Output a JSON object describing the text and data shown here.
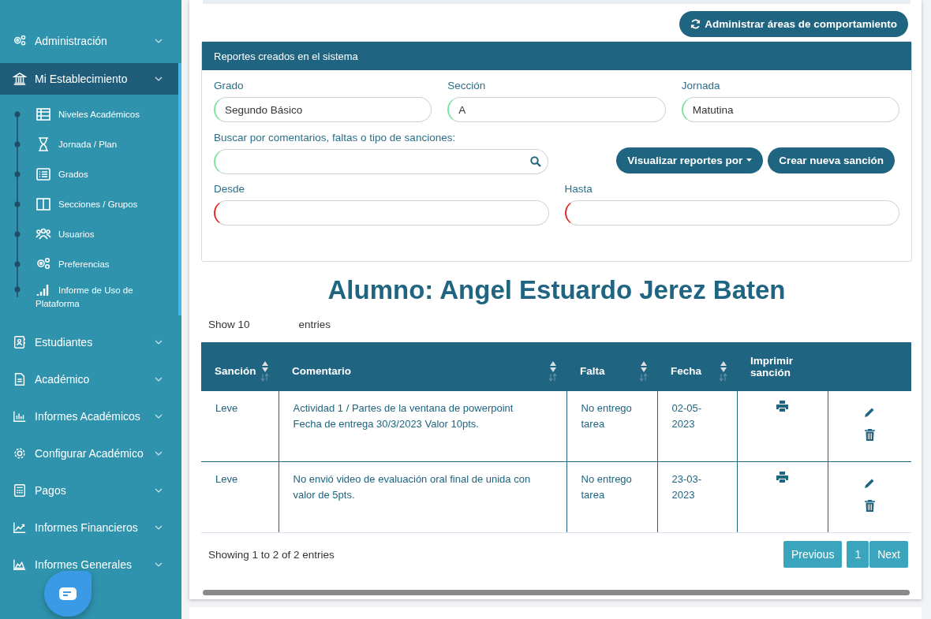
{
  "sidebar": {
    "items": [
      {
        "label": "Administración",
        "selected": false
      },
      {
        "label": "Mi Establecimiento",
        "selected": true,
        "children": [
          {
            "label": "Niveles Académicos"
          },
          {
            "label": "Jornada / Plan"
          },
          {
            "label": "Grados"
          },
          {
            "label": "Secciones / Grupos"
          },
          {
            "label": "Usuarios"
          },
          {
            "label": "Preferencias"
          },
          {
            "label": "Informe de Uso de Plataforma"
          }
        ]
      },
      {
        "label": "Estudiantes",
        "selected": false
      },
      {
        "label": "Académico",
        "selected": false
      },
      {
        "label": "Informes Académicos",
        "selected": false
      },
      {
        "label": "Configurar Académico",
        "selected": false
      },
      {
        "label": "Pagos",
        "selected": false
      },
      {
        "label": "Informes Financieros",
        "selected": false
      },
      {
        "label": "Informes Generales",
        "selected": false
      }
    ]
  },
  "toolbar": {
    "button": "Administrar áreas de comportamiento"
  },
  "panel": {
    "title": "Reportes creados en el sistema",
    "fields": [
      {
        "label": "Grado",
        "value": "Segundo Básico",
        "valid": true
      },
      {
        "label": "Sección",
        "value": "A",
        "valid": true
      },
      {
        "label": "Jornada",
        "value": "Matutina",
        "valid": true
      }
    ],
    "search": {
      "label": "Buscar por comentarios, faltas o tipo de sanciones:",
      "valid": true
    },
    "buttons": [
      {
        "label": "Visualizar reportes por",
        "kind": "dropdown"
      },
      {
        "label": "Crear nueva sanción",
        "kind": "plain"
      }
    ],
    "dates": [
      {
        "label": "Desde",
        "valid": false
      },
      {
        "label": "Hasta",
        "valid": false
      }
    ]
  },
  "student_heading": "Alumno: Angel Estuardo Jerez Baten",
  "length_menu": {
    "before": "Show 10",
    "after": "entries"
  },
  "table": {
    "columns": [
      {
        "label": "Sanción",
        "sortable": true
      },
      {
        "label": "Comentario",
        "sortable": true
      },
      {
        "label": "Falta",
        "sortable": true
      },
      {
        "label": "Fecha",
        "sortable": true
      },
      {
        "label": "Imprimir sanción",
        "sortable": false
      }
    ],
    "rows": [
      {
        "cells": [
          "Leve",
          "Actividad 1 / Partes de la ventana de powerpoint Fecha de entrega 30/3/2023 Valor 10pts.",
          "No entrego tarea",
          "02-05-2023"
        ]
      },
      {
        "cells": [
          "Leve",
          "No envió video de evaluación oral final de unida con valor de 5pts.",
          "No entrego tarea",
          "23-03-2023"
        ]
      }
    ]
  },
  "footer": {
    "info": "Showing 1 to 2 of 2 entries",
    "pages": [
      "Previous",
      "1",
      "Next"
    ]
  }
}
